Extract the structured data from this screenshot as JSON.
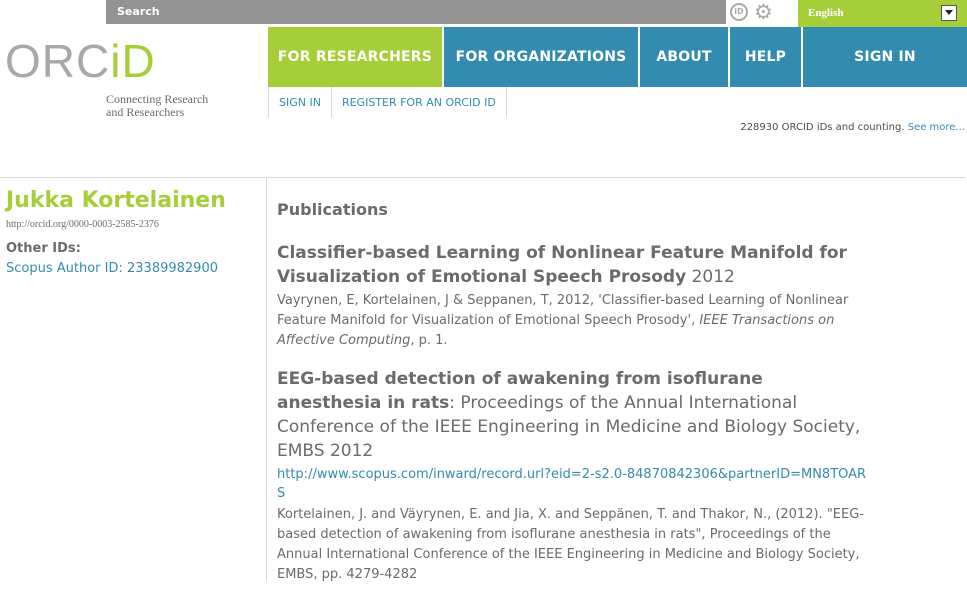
{
  "search": {
    "label": "Search"
  },
  "language": {
    "selected": "English"
  },
  "logo": {
    "text_grey": "ORC",
    "text_green": "iD"
  },
  "tagline": {
    "line1": "Connecting Research",
    "line2": "and Researchers"
  },
  "nav": {
    "items": [
      {
        "label": "FOR RESEARCHERS"
      },
      {
        "label": "FOR ORGANIZATIONS"
      },
      {
        "label": "ABOUT"
      },
      {
        "label": "HELP"
      },
      {
        "label": "SIGN IN"
      }
    ]
  },
  "subnav": {
    "items": [
      {
        "label": "SIGN IN"
      },
      {
        "label": "REGISTER FOR AN ORCID ID"
      }
    ]
  },
  "counter": {
    "text": "228930 ORCID iDs and counting. ",
    "link": "See more..."
  },
  "profile": {
    "name": "Jukka Kortelainen",
    "orcid_url": "http://orcid.org/0000-0003-2585-2376",
    "other_ids_label": "Other IDs:",
    "scopus": "Scopus Author ID: 23389982900"
  },
  "publications": {
    "heading": "Publications",
    "items": [
      {
        "title": "Classifier-based Learning of Nonlinear Feature Manifold for Visualization of Emotional Speech Prosody",
        "year": "2012",
        "cite_pre": "Vayrynen, E, Kortelainen, J & Seppanen, T, 2012, 'Classifier-based Learning of Nonlinear Feature Manifold for Visualization of Emotional Speech Prosody', ",
        "cite_journal": "IEEE Transactions on Affective Computing",
        "cite_post": ", p. 1."
      },
      {
        "title": "EEG-based detection of awakening from isoflurane anesthesia in rats",
        "subtitle": ": Proceedings of the Annual International Conference of the IEEE Engineering in Medicine and Biology Society, EMBS 2012",
        "url": "http://www.scopus.com/inward/record.url?eid=2-s2.0-84870842306&partnerID=MN8TOARS",
        "cite": "Kortelainen, J. and Väyrynen, E. and Jia, X. and Seppänen, T. and Thakor, N., (2012). \"EEG-based detection of awakening from isoflurane anesthesia in rats\", Proceedings of the Annual International Conference of the IEEE Engineering in Medicine and Biology Society, EMBS, pp. 4279-4282"
      }
    ]
  }
}
